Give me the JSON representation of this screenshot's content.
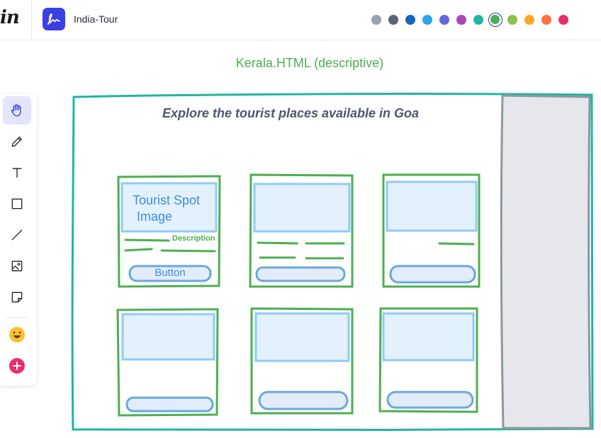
{
  "header": {
    "brand": "in",
    "project_title": "India-Tour",
    "colors": [
      "#9aa0b0",
      "#5d6277",
      "#1565c0",
      "#2aa5e8",
      "#5f6ad6",
      "#ab47bc",
      "#1fb5a4",
      "#4caf50",
      "#8bc34a",
      "#f9a825",
      "#ff7043",
      "#ec2c6b"
    ],
    "selected_color": "#4caf50"
  },
  "frame": {
    "label": "Kerala.HTML (descriptive)",
    "heading": "Explore the tourist places available in Goa",
    "border_color": "#1fb5a4"
  },
  "cards": {
    "image_label_line1": "Tourist Spot",
    "image_label_line2": "Image",
    "description_label": "Description",
    "button_label": "Button",
    "count": 6
  },
  "toolbar": {
    "tools": [
      "hand-icon",
      "pencil-icon",
      "text-icon",
      "rectangle-icon",
      "line-icon",
      "image-icon",
      "sticky-note-icon",
      "emoji-icon",
      "add-icon"
    ],
    "active_tool": "hand-icon"
  }
}
